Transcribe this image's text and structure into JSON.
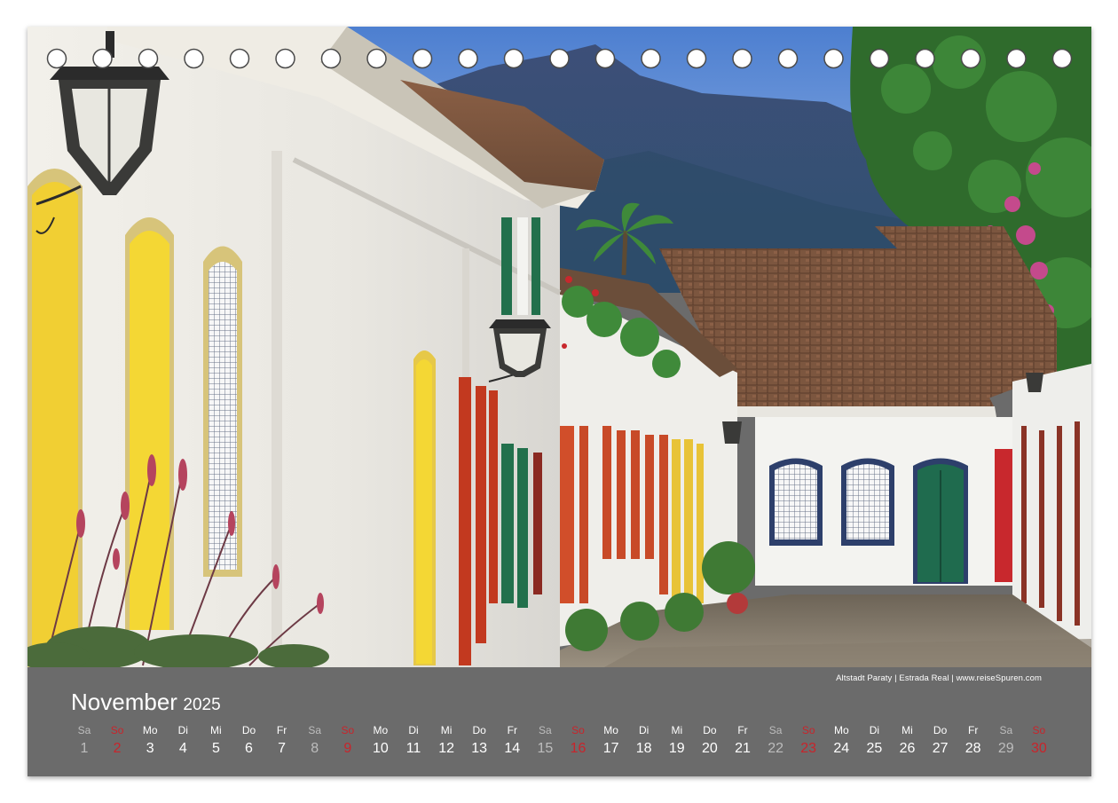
{
  "photo": {
    "caption": "Altstadt Paraty  |  Estrada Real  |  www.reiseSpuren.com"
  },
  "calendar": {
    "month": "November",
    "year": "2025",
    "days": [
      {
        "weekday": "Sa",
        "day": "1",
        "kind": "sat"
      },
      {
        "weekday": "So",
        "day": "2",
        "kind": "sun"
      },
      {
        "weekday": "Mo",
        "day": "3",
        "kind": "wk"
      },
      {
        "weekday": "Di",
        "day": "4",
        "kind": "wk"
      },
      {
        "weekday": "Mi",
        "day": "5",
        "kind": "wk"
      },
      {
        "weekday": "Do",
        "day": "6",
        "kind": "wk"
      },
      {
        "weekday": "Fr",
        "day": "7",
        "kind": "wk"
      },
      {
        "weekday": "Sa",
        "day": "8",
        "kind": "sat"
      },
      {
        "weekday": "So",
        "day": "9",
        "kind": "sun"
      },
      {
        "weekday": "Mo",
        "day": "10",
        "kind": "wk"
      },
      {
        "weekday": "Di",
        "day": "11",
        "kind": "wk"
      },
      {
        "weekday": "Mi",
        "day": "12",
        "kind": "wk"
      },
      {
        "weekday": "Do",
        "day": "13",
        "kind": "wk"
      },
      {
        "weekday": "Fr",
        "day": "14",
        "kind": "wk"
      },
      {
        "weekday": "Sa",
        "day": "15",
        "kind": "sat"
      },
      {
        "weekday": "So",
        "day": "16",
        "kind": "sun"
      },
      {
        "weekday": "Mo",
        "day": "17",
        "kind": "wk"
      },
      {
        "weekday": "Di",
        "day": "18",
        "kind": "wk"
      },
      {
        "weekday": "Mi",
        "day": "19",
        "kind": "wk"
      },
      {
        "weekday": "Do",
        "day": "20",
        "kind": "wk"
      },
      {
        "weekday": "Fr",
        "day": "21",
        "kind": "wk"
      },
      {
        "weekday": "Sa",
        "day": "22",
        "kind": "sat"
      },
      {
        "weekday": "So",
        "day": "23",
        "kind": "sun"
      },
      {
        "weekday": "Mo",
        "day": "24",
        "kind": "wk"
      },
      {
        "weekday": "Di",
        "day": "25",
        "kind": "wk"
      },
      {
        "weekday": "Mi",
        "day": "26",
        "kind": "wk"
      },
      {
        "weekday": "Do",
        "day": "27",
        "kind": "wk"
      },
      {
        "weekday": "Fr",
        "day": "28",
        "kind": "wk"
      },
      {
        "weekday": "Sa",
        "day": "29",
        "kind": "sat"
      },
      {
        "weekday": "So",
        "day": "30",
        "kind": "sun"
      }
    ]
  },
  "colors": {
    "band": "#6b6b6b",
    "sunday": "#c9242b",
    "saturday": "#bdbdbd",
    "text": "#ffffff"
  }
}
